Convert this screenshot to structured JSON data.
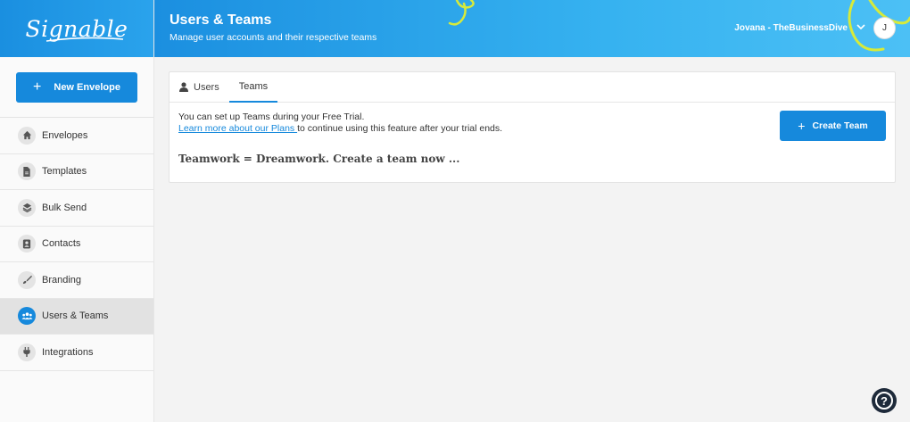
{
  "brand": {
    "logo_text": "Signable",
    "accent": "#1689dc"
  },
  "sidebar": {
    "new_envelope_label": "New Envelope",
    "items": [
      {
        "label": "Envelopes",
        "icon": "home-icon"
      },
      {
        "label": "Templates",
        "icon": "document-icon"
      },
      {
        "label": "Bulk Send",
        "icon": "layers-icon"
      },
      {
        "label": "Contacts",
        "icon": "contact-card-icon"
      },
      {
        "label": "Branding",
        "icon": "brush-icon"
      },
      {
        "label": "Users & Teams",
        "icon": "users-icon",
        "active": true
      },
      {
        "label": "Integrations",
        "icon": "plug-icon"
      }
    ]
  },
  "header": {
    "title": "Users & Teams",
    "subtitle": "Manage user accounts and their respective teams",
    "user_name": "Jovana - TheBusinessDive",
    "avatar_initial": "J"
  },
  "tabs": [
    {
      "label": "Users",
      "icon": "user-icon"
    },
    {
      "label": "Teams",
      "active": true
    }
  ],
  "teams": {
    "info_line1": "You can set up Teams during your Free Trial.",
    "info_link": "Learn more about our Plans ",
    "info_line2_rest": "to continue using this feature after your trial ends.",
    "create_button": "Create Team",
    "empty_message": "Teamwork = Dreamwork. Create a team now ..."
  },
  "help": {
    "label": "?"
  }
}
